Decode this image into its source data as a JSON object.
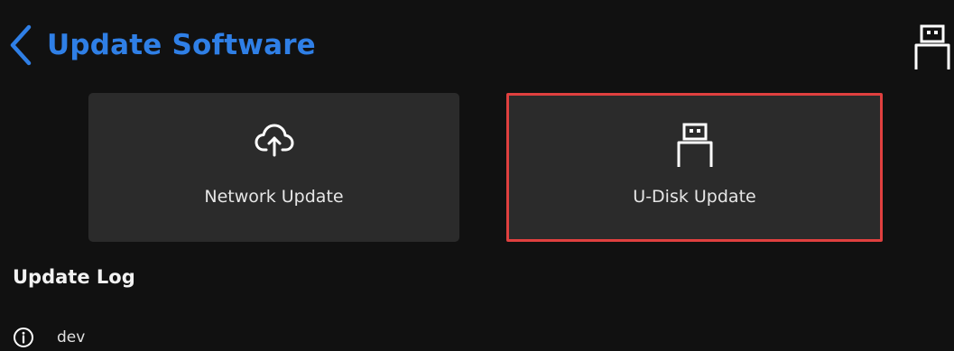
{
  "header": {
    "title": "Update Software",
    "back_icon": "chevron-left-icon",
    "status_icon": "usb-drive-icon",
    "accent_color": "#2f7fe6"
  },
  "options": {
    "network": {
      "label": "Network Update",
      "icon": "cloud-upload-icon"
    },
    "udisk": {
      "label": "U-Disk Update",
      "icon": "usb-drive-icon",
      "highlight_color": "#e0403f"
    }
  },
  "update_log": {
    "title": "Update Log",
    "entries": [
      {
        "icon": "info-icon",
        "text": "dev"
      }
    ]
  }
}
